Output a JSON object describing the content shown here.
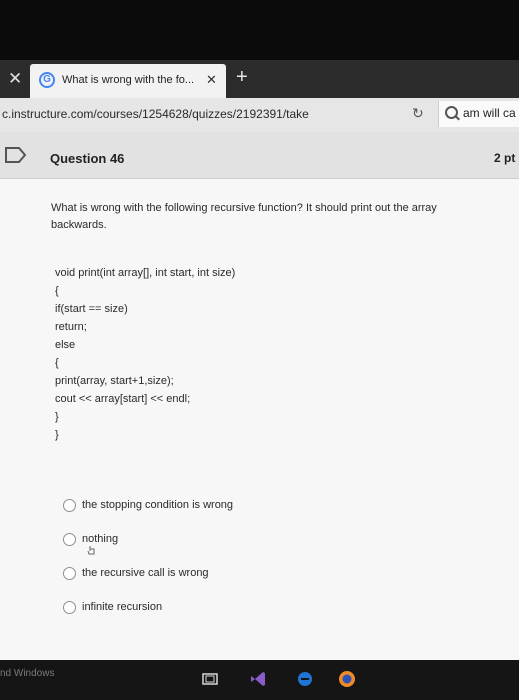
{
  "browser": {
    "tab_close_glyph": "✕",
    "tab_favicon": "G",
    "tab_title": "What is wrong with the fo...",
    "tab_close": "✕",
    "new_tab": "+",
    "url": "c.instructure.com/courses/1254628/quizzes/2192391/take",
    "reload_glyph": "↻",
    "search_text": "am will ca"
  },
  "question": {
    "number_label": "Question 46",
    "points": "2 pt",
    "text": "What is wrong with the following recursive function? It should print out the array backwards.",
    "code": [
      "void print(int array[], int start, int size)",
      "{",
      "if(start == size)",
      "return;",
      "else",
      "{",
      "print(array, start+1,size);",
      "cout << array[start] << endl;",
      "}",
      "}"
    ],
    "answers": [
      "the stopping condition is wrong",
      "nothing",
      "the recursive call is wrong",
      "infinite recursion"
    ]
  },
  "taskbar": {
    "watermark": "nd Windows",
    "icons": [
      "task-view-icon",
      "visual-studio-icon",
      "edge-icon",
      "firefox-icon"
    ]
  },
  "colors": {
    "accent_blue": "#4285f4",
    "vs_purple": "#8a5cc7",
    "edge_blue": "#1f74d4",
    "firefox_orange": "#f08a24"
  }
}
